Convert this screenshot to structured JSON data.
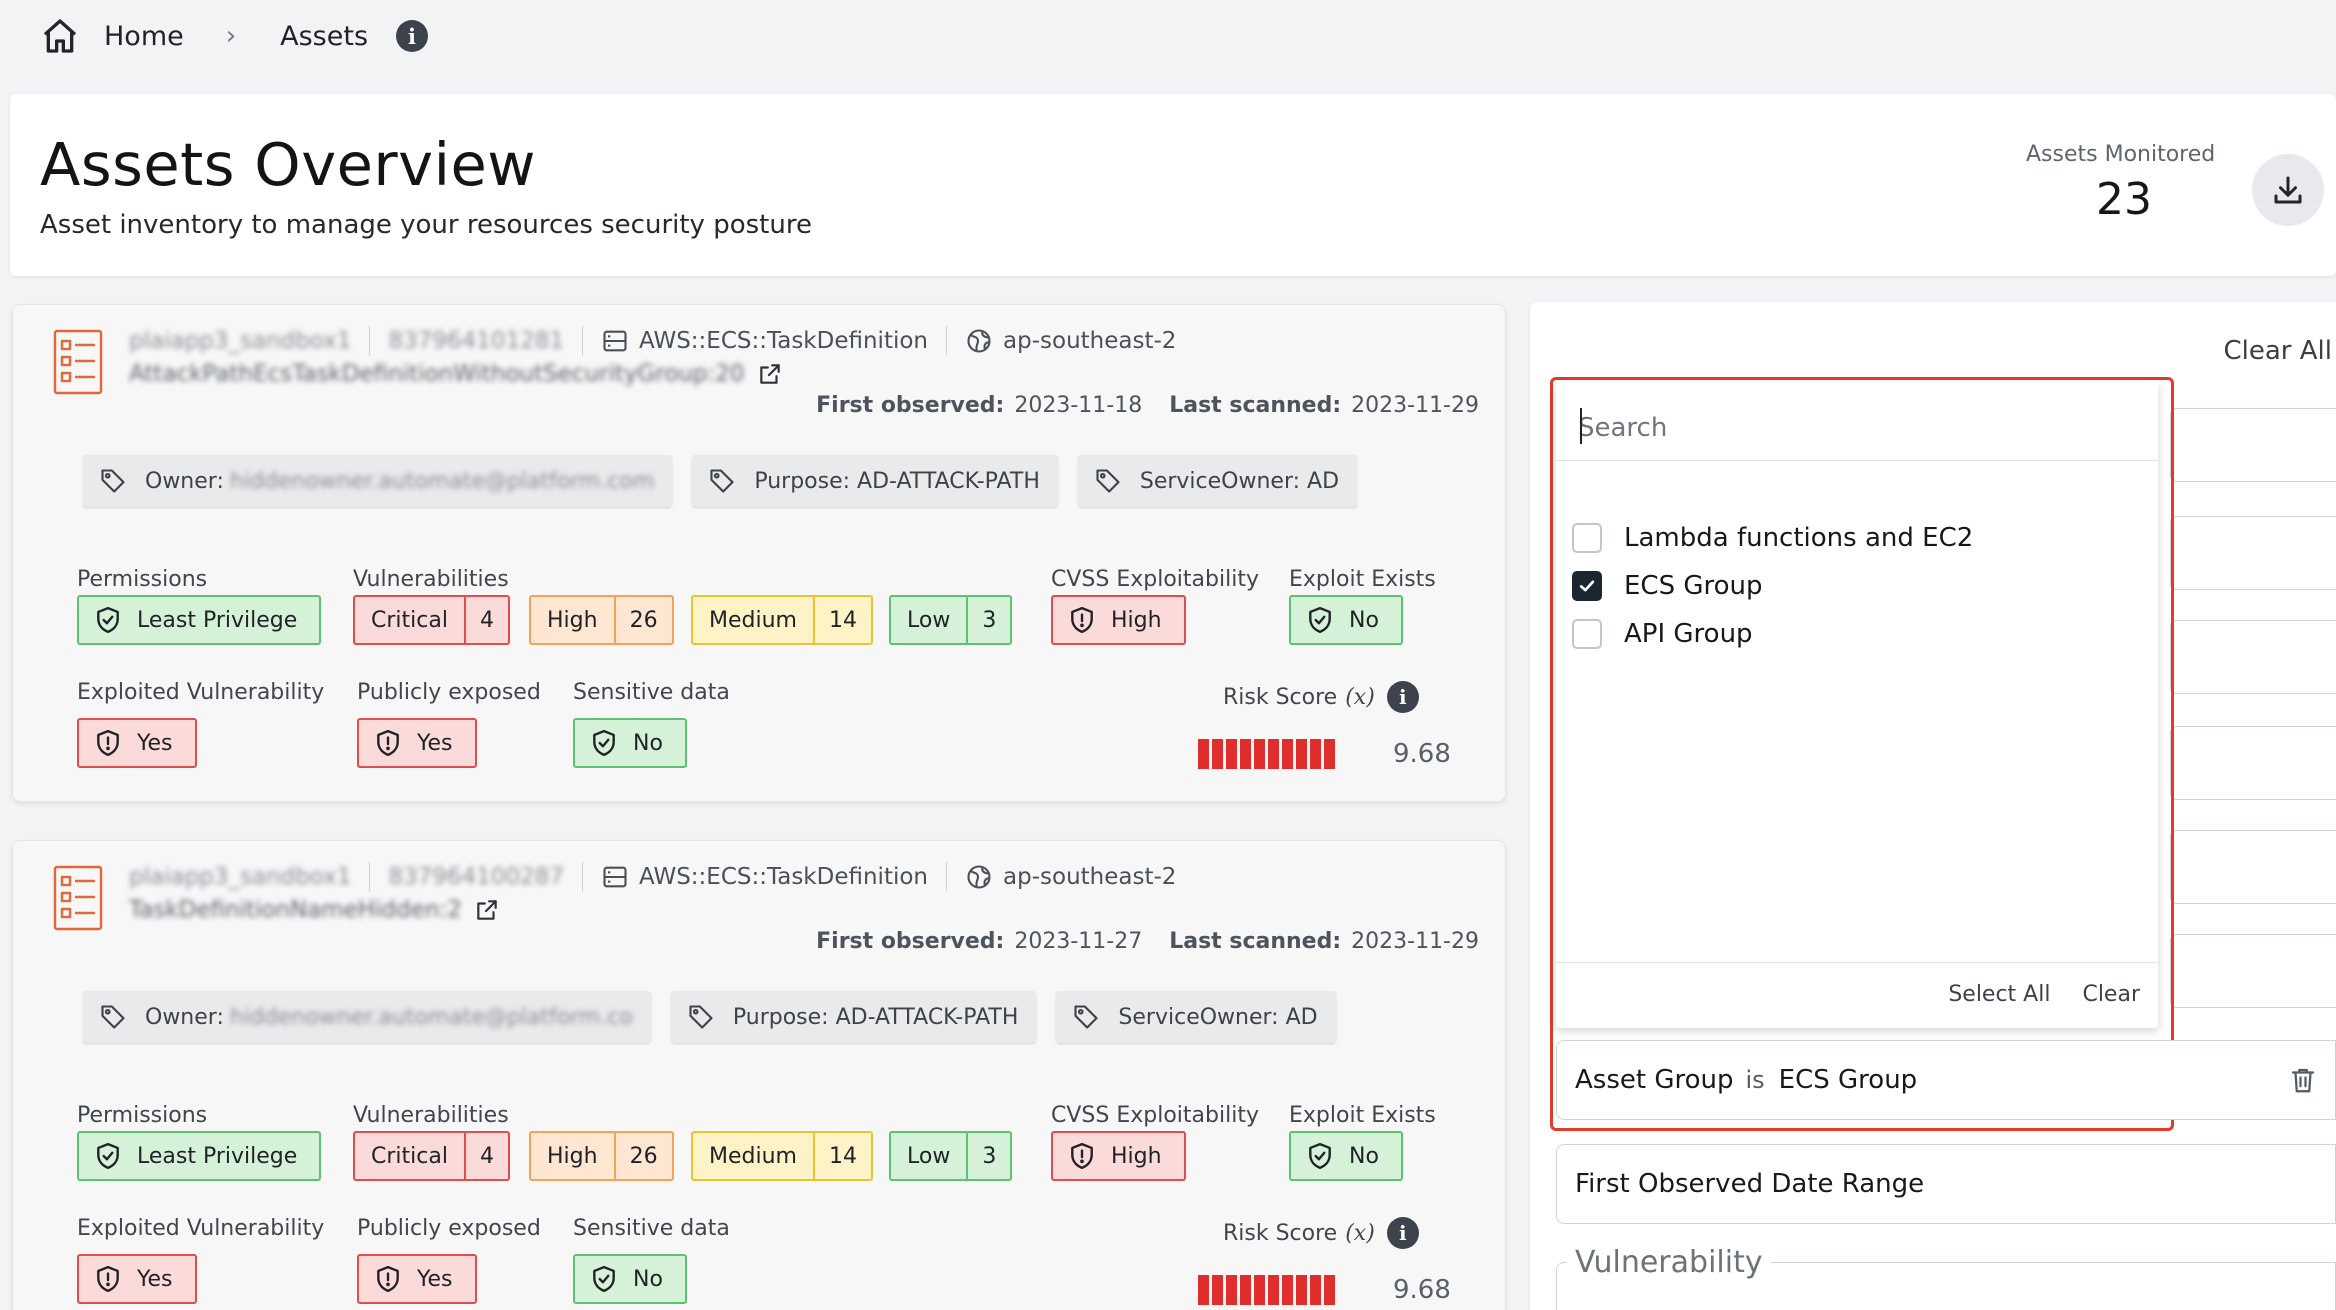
{
  "breadcrumb": {
    "home": "Home",
    "separator": "›",
    "current": "Assets",
    "info_icon": "i"
  },
  "header": {
    "title": "Assets Overview",
    "subtitle": "Asset inventory to manage your resources security posture",
    "monitored_label": "Assets Monitored",
    "monitored_value": "23",
    "download_icon": "download-icon"
  },
  "labels": {
    "permissions": "Permissions",
    "vulnerabilities": "Vulnerabilities",
    "cvss": "CVSS Exploitability",
    "exploit": "Exploit Exists",
    "exploited_vuln": "Exploited Vulnerability",
    "publicly_exposed": "Publicly exposed",
    "sensitive": "Sensitive data",
    "risk_score": "Risk Score",
    "risk_x": "(x)",
    "info_glyph": "i",
    "first_observed": "First observed:",
    "last_scanned": "Last scanned:",
    "owner": "Owner:",
    "critical": "Critical",
    "high": "High",
    "medium": "Medium",
    "low": "Low"
  },
  "assets": [
    {
      "account_name": "plaiapp3_sandbox1",
      "account_id": "837964101281",
      "type": "AWS::ECS::TaskDefinition",
      "region": "ap-southeast-2",
      "resource_name": "AttackPathEcsTaskDefinitionWithoutSecurityGroup:20",
      "first_observed": "2023-11-18",
      "last_scanned": "2023-11-29",
      "owner": "hiddenowner.automate@platform.com",
      "purpose": "Purpose: AD-ATTACK-PATH",
      "service_owner": "ServiceOwner: AD",
      "permissions": "Least Privilege",
      "vulns": {
        "critical": "4",
        "high": "26",
        "medium": "14",
        "low": "3"
      },
      "cvss": "High",
      "exploit_exists": "No",
      "exploited_vuln": "Yes",
      "publicly_exposed": "Yes",
      "sensitive": "No",
      "risk_score": "9.68"
    },
    {
      "account_name": "plaiapp3_sandbox1",
      "account_id": "837964100287",
      "type": "AWS::ECS::TaskDefinition",
      "region": "ap-southeast-2",
      "resource_name": "TaskDefinitionNameHidden:2",
      "first_observed": "2023-11-27",
      "last_scanned": "2023-11-29",
      "owner": "hiddenowner.automate@platform.co",
      "purpose": "Purpose: AD-ATTACK-PATH",
      "service_owner": "ServiceOwner: AD",
      "permissions": "Least Privilege",
      "vulns": {
        "critical": "4",
        "high": "26",
        "medium": "14",
        "low": "3"
      },
      "cvss": "High",
      "exploit_exists": "No",
      "exploited_vuln": "Yes",
      "publicly_exposed": "Yes",
      "sensitive": "No",
      "risk_score": "9.68"
    }
  ],
  "filters": {
    "clear_all": "Clear All",
    "search_placeholder": "Search",
    "options": [
      {
        "label": "Lambda functions and EC2",
        "checked": false
      },
      {
        "label": "ECS Group",
        "checked": true
      },
      {
        "label": "API Group",
        "checked": false
      }
    ],
    "select_all": "Select All",
    "clear": "Clear",
    "asset_group_field": "Asset Group",
    "asset_group_op": "is",
    "asset_group_value": "ECS Group",
    "first_observed_range": "First Observed Date Range",
    "vulnerability_legend": "Vulnerability"
  },
  "colors": {
    "critical_red": "#e02d2d",
    "highlight_border": "#e23b2a",
    "checkbox_checked": "#1b2633"
  }
}
